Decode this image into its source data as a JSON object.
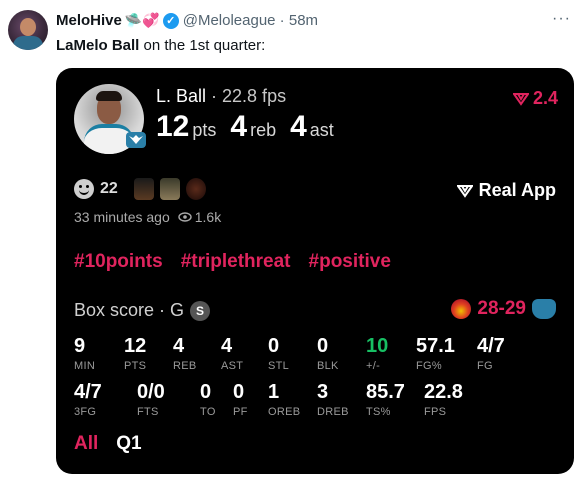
{
  "tweet": {
    "author_name": "MeloHive",
    "author_emojis": "🛸💞",
    "handle_time": "@Meloleague · 58m",
    "more": "···",
    "text_bold": "LaMelo Ball",
    "text_rest": " on the 1st quarter:"
  },
  "card": {
    "player_name": "L. Ball",
    "fps_text": " · 22.8 fps",
    "pts": "12",
    "pts_unit": "pts",
    "reb": "4",
    "reb_unit": "reb",
    "ast": "4",
    "ast_unit": "ast",
    "delta": "2.4",
    "reaction_count": "22",
    "real_app": "Real App",
    "time_ago": "33 minutes ago",
    "views": "1.6k",
    "hashtags": [
      "#10points",
      "#triplethreat",
      "#positive"
    ],
    "box_title": "Box score · G",
    "box_badge": "S",
    "score": "28-29",
    "stats_row1": [
      {
        "value": "9",
        "label": "MIN"
      },
      {
        "value": "12",
        "label": "PTS"
      },
      {
        "value": "4",
        "label": "REB"
      },
      {
        "value": "4",
        "label": "AST"
      },
      {
        "value": "0",
        "label": "STL"
      },
      {
        "value": "0",
        "label": "BLK"
      },
      {
        "value": "10",
        "label": "+/-"
      },
      {
        "value": "57.1",
        "label": "FG%"
      },
      {
        "value": "4/7",
        "label": "FG"
      }
    ],
    "stats_row2": [
      {
        "value": "4/7",
        "label": "3FG"
      },
      {
        "value": "0/0",
        "label": "FTS"
      },
      {
        "value": "0",
        "label": "TO"
      },
      {
        "value": "0",
        "label": "PF"
      },
      {
        "value": "1",
        "label": "OREB"
      },
      {
        "value": "3",
        "label": "DREB"
      },
      {
        "value": "85.7",
        "label": "TS%"
      },
      {
        "value": "22.8",
        "label": "FPS"
      }
    ],
    "tabs": [
      "All",
      "Q1"
    ],
    "accent": "#e0245e",
    "positive_color": "#17bf63"
  }
}
